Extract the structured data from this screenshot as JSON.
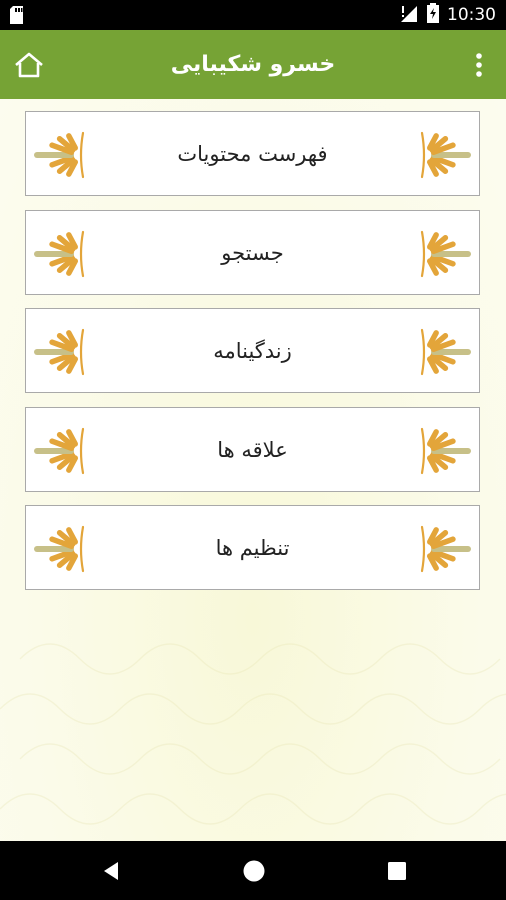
{
  "status_bar": {
    "time": "10:30"
  },
  "toolbar": {
    "title": "خسرو شکیبایی",
    "home_icon": "home-icon",
    "menu_icon": "more-vert-icon",
    "color": "#76a335"
  },
  "menu": {
    "items": [
      {
        "label": "فهرست محتویات"
      },
      {
        "label": "جستجو"
      },
      {
        "label": "زندگینامه"
      },
      {
        "label": "علاقه ها"
      },
      {
        "label": "تنظیم ها"
      }
    ],
    "ornament_colors": [
      "#e3a53a",
      "#c7c088"
    ]
  },
  "navigation": {
    "back_icon": "back-triangle-icon",
    "home_icon": "home-circle-icon",
    "recents_icon": "recents-square-icon"
  }
}
